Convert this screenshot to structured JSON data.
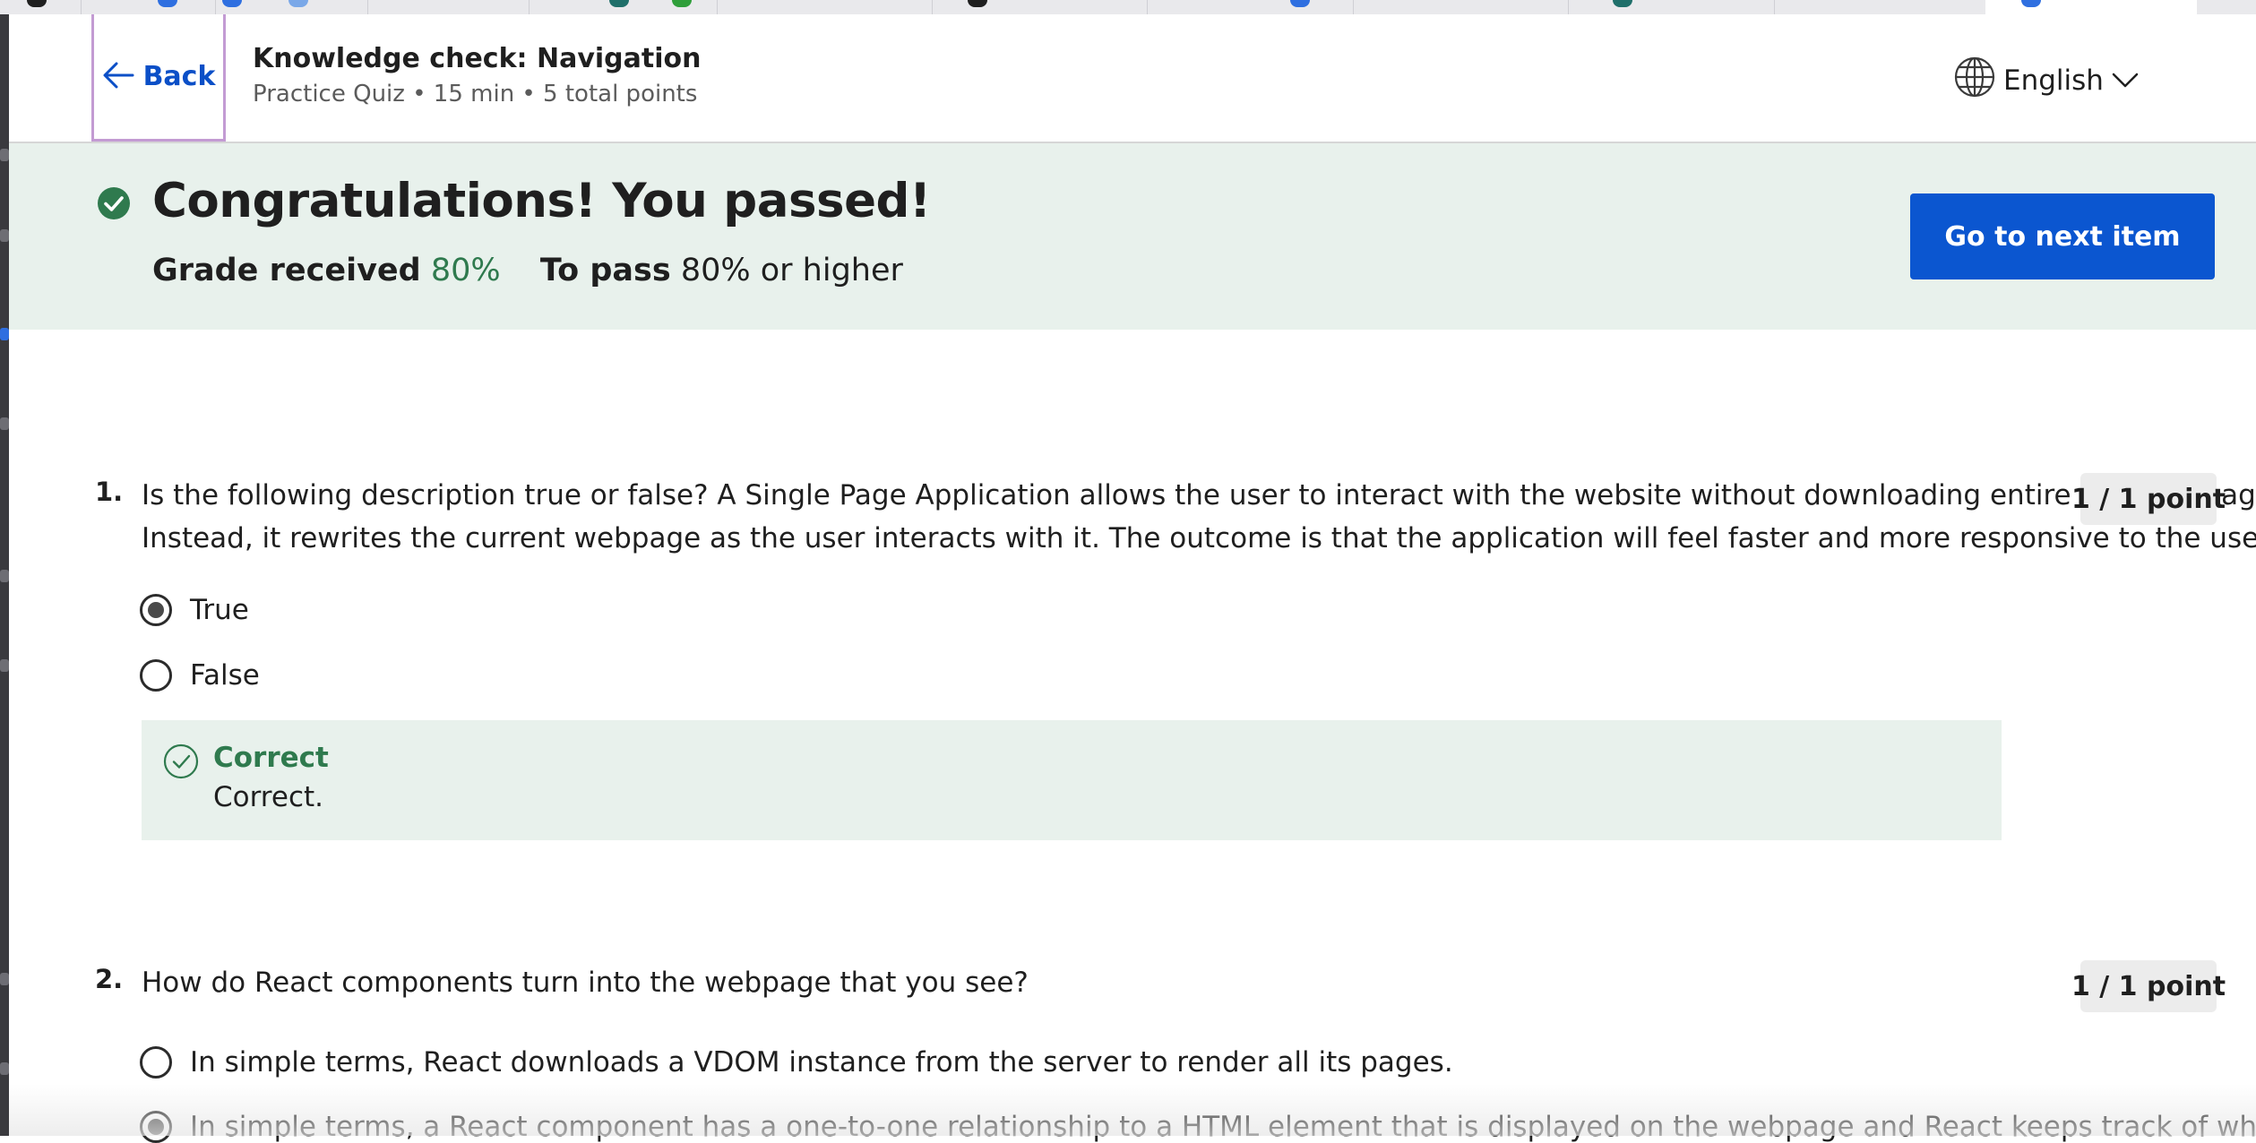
{
  "header": {
    "back_label": "Back",
    "title": "Knowledge check: Navigation",
    "subtitle": "Practice Quiz • 15 min • 5 total points",
    "language": "English"
  },
  "banner": {
    "headline": "Congratulations! You passed!",
    "grade_label": "Grade received",
    "grade_value": "80%",
    "pass_label": "To pass",
    "pass_value": "80% or higher",
    "next_button": "Go to next item"
  },
  "questions": [
    {
      "number": "1.",
      "text_line1": "Is the following description true or false? A Single Page Application allows the user to interact with the website without downloading entire new webpages.",
      "text_line2": "Instead, it rewrites the current webpage as the user interacts with it. The outcome is that the application will feel faster and more responsive to the user.",
      "points": "1 / 1 point",
      "options": [
        {
          "label": "True",
          "selected": true
        },
        {
          "label": "False",
          "selected": false
        }
      ],
      "feedback": {
        "title": "Correct",
        "text": "Correct."
      }
    },
    {
      "number": "2.",
      "text_line1": "How do React components turn into the webpage that you see?",
      "points": "1 / 1 point",
      "options": [
        {
          "label": "In simple terms, React downloads a VDOM instance from the server to render all its pages.",
          "selected": false
        },
        {
          "label": "In simple terms, a React component has a one-to-one relationship to a HTML element that is displayed on the webpage and React keeps track of which",
          "selected": true
        }
      ]
    }
  ],
  "colors": {
    "accent_blue": "#0b56d0",
    "success_green": "#2f7a4e",
    "banner_bg": "#e8f1ec"
  },
  "icons": {
    "back": "arrow-left-icon",
    "language": "globe-icon",
    "dropdown": "chevron-down-icon",
    "passed": "check-circle-icon",
    "feedback": "check-outline-icon"
  }
}
